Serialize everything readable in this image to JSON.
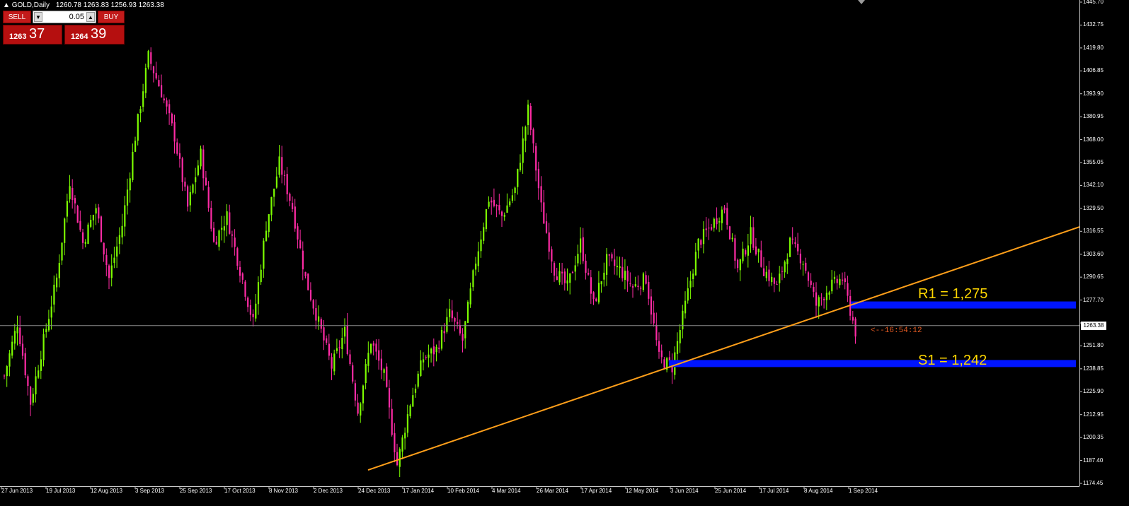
{
  "header": {
    "symbol": "GOLD,Daily",
    "ohlc": "1260.78 1263.83 1256.93 1263.38"
  },
  "trade_panel": {
    "sell_label": "SELL",
    "buy_label": "BUY",
    "lot_value": "0.05",
    "sell_price_big": "1263",
    "sell_price_small": "37",
    "buy_price_big": "1264",
    "buy_price_small": "39",
    "button_color": "#c21a1a"
  },
  "chart_data": {
    "type": "candlestick",
    "y_range": [
      1170,
      1447
    ],
    "y_ticks": [
      "1445.70",
      "1432.75",
      "1419.80",
      "1406.85",
      "1393.90",
      "1380.95",
      "1368.00",
      "1355.05",
      "1342.10",
      "1329.50",
      "1316.55",
      "1303.60",
      "1290.65",
      "1277.70",
      "1263.38",
      "1251.80",
      "1238.85",
      "1225.90",
      "1212.95",
      "1200.35",
      "1187.40",
      "1174.45"
    ],
    "x_ticks": [
      "27 Jun 2013",
      "19 Jul 2013",
      "12 Aug 2013",
      "3 Sep 2013",
      "25 Sep 2013",
      "17 Oct 2013",
      "8 Nov 2013",
      "2 Dec 2013",
      "24 Dec 2013",
      "17 Jan 2014",
      "10 Feb 2014",
      "4 Mar 2014",
      "26 Mar 2014",
      "17 Apr 2014",
      "12 May 2014",
      "3 Jun 2014",
      "25 Jun 2014",
      "17 Jul 2014",
      "8 Aug 2014",
      "1 Sep 2014"
    ],
    "price_path": [
      1235,
      1265,
      1220,
      1255,
      1290,
      1345,
      1310,
      1330,
      1290,
      1320,
      1370,
      1415,
      1395,
      1370,
      1330,
      1360,
      1310,
      1325,
      1295,
      1265,
      1320,
      1355,
      1330,
      1290,
      1265,
      1240,
      1260,
      1215,
      1255,
      1235,
      1185,
      1220,
      1245,
      1250,
      1270,
      1255,
      1300,
      1335,
      1325,
      1340,
      1385,
      1330,
      1295,
      1285,
      1310,
      1275,
      1300,
      1295,
      1285,
      1290,
      1245,
      1240,
      1275,
      1310,
      1320,
      1330,
      1295,
      1315,
      1295,
      1285,
      1310,
      1300,
      1275,
      1285,
      1290,
      1260
    ],
    "current_price": "1263.38",
    "countdown": "<--16:54:12",
    "bull_color": "#7cfc00",
    "bear_color": "#ff2ba5",
    "trendline_color": "#ff9f1a",
    "zone_color": "#0015ff",
    "trendline": {
      "start_price": 1182,
      "end_price": 1319
    },
    "resistance": {
      "label": "R1 = 1,275",
      "value": 1275
    },
    "support": {
      "label": "S1 = 1,242",
      "value": 1242
    }
  }
}
